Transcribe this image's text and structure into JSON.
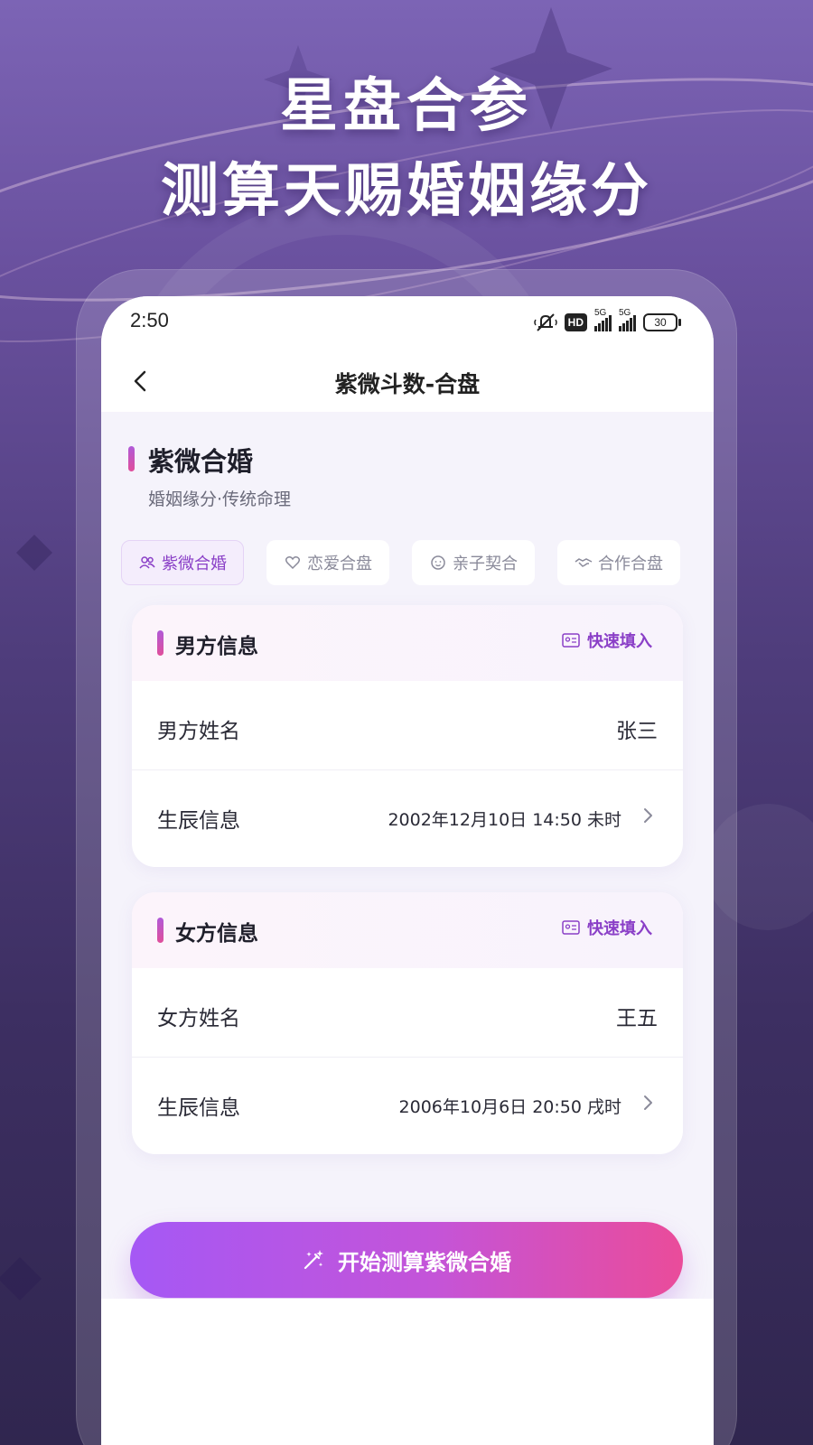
{
  "headline": {
    "line1": "星盘合参",
    "line2": "测算天赐婚姻缘分"
  },
  "status_bar": {
    "time": "2:50",
    "hd_badge": "HD",
    "network_1": "5G",
    "network_2": "5G",
    "battery": "30"
  },
  "nav": {
    "title": "紫微斗数-合盘"
  },
  "section": {
    "title": "紫微合婚",
    "subtitle": "婚姻缘分·传统命理"
  },
  "tabs": [
    {
      "label": "紫微合婚",
      "icon": "people-icon",
      "active": true
    },
    {
      "label": "恋爱合盘",
      "icon": "heart-icon",
      "active": false
    },
    {
      "label": "亲子契合",
      "icon": "baby-face-icon",
      "active": false
    },
    {
      "label": "合作合盘",
      "icon": "handshake-icon",
      "active": false
    }
  ],
  "male_card": {
    "title": "男方信息",
    "quick_fill": "快速填入",
    "name_label": "男方姓名",
    "name_value": "张三",
    "birth_label": "生辰信息",
    "birth_value": "2002年12月10日 14:50 未时"
  },
  "female_card": {
    "title": "女方信息",
    "quick_fill": "快速填入",
    "name_label": "女方姓名",
    "name_value": "王五",
    "birth_label": "生辰信息",
    "birth_value": "2006年10月6日 20:50 戌时"
  },
  "start_button": {
    "label": "开始测算紫微合婚"
  },
  "colors": {
    "accent_purple": "#8a3fc7",
    "button_gradient_start": "#a558f5",
    "button_gradient_end": "#ea4c9a",
    "background_top": "#7c64b5",
    "background_bottom": "#30264f"
  }
}
